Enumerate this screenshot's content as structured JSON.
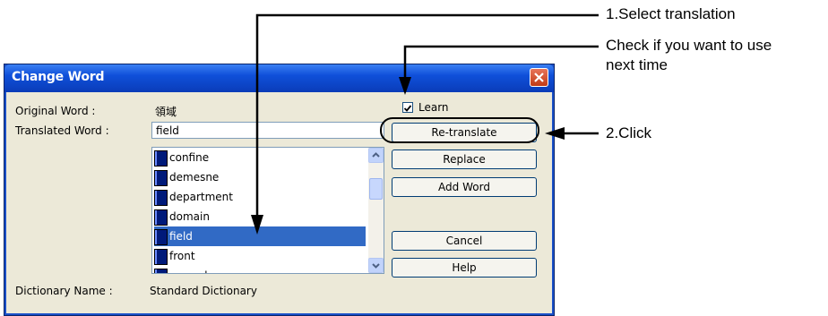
{
  "annotations": {
    "step1": "1.Select translation",
    "check_line1": "Check if you want to use",
    "check_line2": "next time",
    "step2": "2.Click"
  },
  "dialog": {
    "title": "Change Word",
    "original_word_label": "Original Word :",
    "original_word_value": "領域",
    "translated_word_label": "Translated Word :",
    "translated_word_value": "field",
    "learn_label": "Learn",
    "learn_checked": true,
    "list_items": [
      "confine",
      "demesne",
      "department",
      "domain",
      "field",
      "front",
      "ground"
    ],
    "selected_item": "field",
    "buttons": {
      "retranslate": "Re-translate",
      "replace": "Replace",
      "add_word": "Add Word",
      "cancel": "Cancel",
      "help": "Help"
    },
    "dictionary_label": "Dictionary Name :",
    "dictionary_value": "Standard Dictionary"
  },
  "colors": {
    "titlebar": "#0f4fd9",
    "selection": "#316ac5",
    "close_button": "#c23a16"
  }
}
